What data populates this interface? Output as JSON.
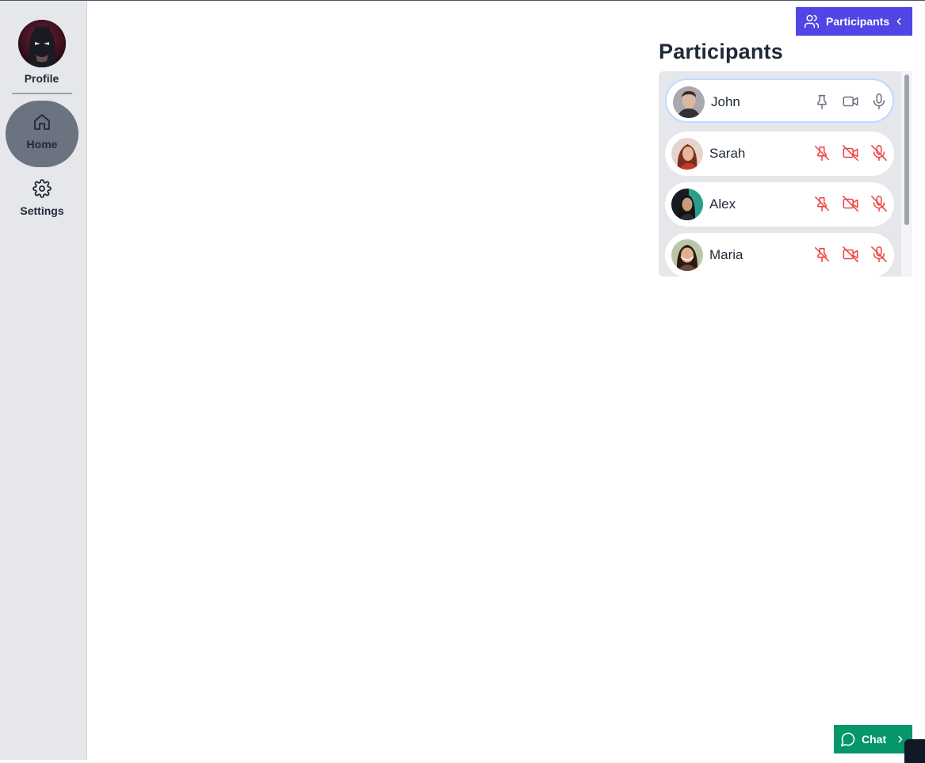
{
  "sidebar": {
    "profile_label": "Profile",
    "items": [
      {
        "label": "Home",
        "icon": "home-icon",
        "active": true
      },
      {
        "label": "Settings",
        "icon": "gear-icon",
        "active": false
      }
    ]
  },
  "participants_toggle": {
    "label": "Participants",
    "icon": "users-icon"
  },
  "panel": {
    "title": "Participants",
    "participants": [
      {
        "name": "John",
        "pinned_state": "pin-icon",
        "video": "video-icon",
        "mic": "mic-icon",
        "selected": true
      },
      {
        "name": "Sarah",
        "pinned_state": "pin-off-icon",
        "video": "video-off-icon",
        "mic": "mic-off-icon"
      },
      {
        "name": "Alex",
        "pinned_state": "pin-off-icon",
        "video": "video-off-icon",
        "mic": "mic-off-icon"
      },
      {
        "name": "Maria",
        "pinned_state": "pin-off-icon",
        "video": "video-off-icon",
        "mic": "mic-off-icon"
      }
    ]
  },
  "chat": {
    "label": "Chat",
    "icon": "chat-icon"
  },
  "colors": {
    "accent": "#4f46e5",
    "chat": "#059669",
    "muted_red": "#ef4444",
    "sidebar_bg": "#e5e7eb",
    "active_nav": "#6b7280"
  }
}
